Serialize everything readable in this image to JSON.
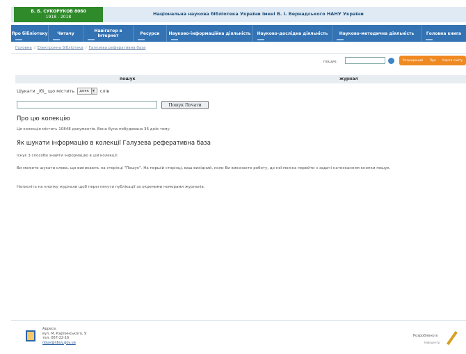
{
  "header": {
    "logo_line1": "Б. Б. СУКОРУКОВ 8060",
    "logo_line2": "1918 - 2018",
    "library_title": "Національна наукова бібліотека України імені В. І. Вернадського НАНУ України"
  },
  "nav": {
    "items": [
      {
        "label": "Про бібліотеку"
      },
      {
        "label": "Читачу"
      },
      {
        "label": "Навігатор в Інтернет"
      },
      {
        "label": "Ресурси"
      },
      {
        "label": "Науково-інформаційна діяльність"
      },
      {
        "label": "Науково-дослідна діяльність"
      },
      {
        "label": "Науково-методична діяльність"
      },
      {
        "label": "Головна книга"
      }
    ]
  },
  "breadcrumb": {
    "items": [
      "Головна",
      "Електронна бібліотека",
      "Галузева реферативна база"
    ]
  },
  "quick_search": {
    "label": "пошук:",
    "value": "",
    "orange_labels": [
      "Розширений",
      "Про",
      "Карта сайту"
    ]
  },
  "tabs": {
    "search": "пошук",
    "journal": "журнал"
  },
  "search_form": {
    "prefix": "Шукати _ібі_ що містить",
    "select_value": "деяк",
    "suffix": "слів",
    "query_value": "",
    "button_label": "Пошук Почати"
  },
  "content": {
    "about_heading": "Про цю колекцію",
    "about_text": "Ця колекція містить 10848 документів. Вона була побудована 36 днів тому.",
    "how_heading": "Як шукати інформацію в колекції Галузева реферативна база",
    "how_text": "Існує 3 способи знайти інформацію в цій колекції:",
    "para1": "Ви можете шукати слова, що виникають на сторінці \"Пошук\". На першій сторінці, ваш вихідний, коли Ви виконаєте роботу, до неї можна перейти з задачі натисканням кнопки пошук.",
    "para2": "Натисніть на кнопку журнали щоб переглянути публікації за окремими номерами журналів."
  },
  "footer": {
    "address_lines": [
      "Адреса:",
      "вул. М. Карпинського, 9",
      "тел. 067-22-16"
    ],
    "email": "nbuv@nbuv.gov.ua",
    "developer_label": "Розроблено в",
    "developer_sub": "Інфоцентр"
  },
  "colors": {
    "nav_bg": "#3372b3",
    "logo_bg": "#2f8a2a",
    "accent_orange": "#ef8a23"
  }
}
